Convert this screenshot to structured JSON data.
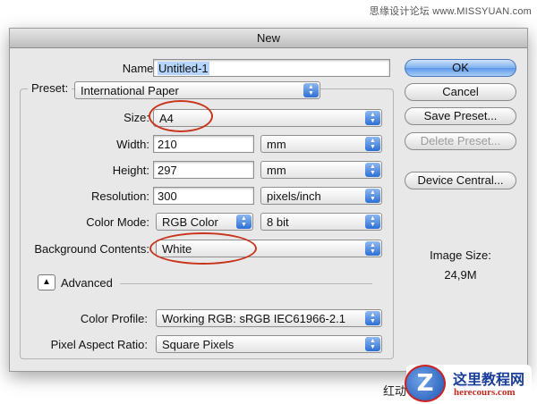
{
  "watermark_top": "思缘设计论坛 www.MISSYUAN.com",
  "dialog": {
    "title": "New",
    "name": {
      "label": "Name:",
      "value": "Untitled-1"
    },
    "preset": {
      "label": "Preset:",
      "value": "International Paper"
    },
    "size": {
      "label": "Size:",
      "value": "A4"
    },
    "width": {
      "label": "Width:",
      "value": "210",
      "unit": "mm"
    },
    "height": {
      "label": "Height:",
      "value": "297",
      "unit": "mm"
    },
    "resolution": {
      "label": "Resolution:",
      "value": "300",
      "unit": "pixels/inch"
    },
    "color_mode": {
      "label": "Color Mode:",
      "value": "RGB Color",
      "depth": "8 bit"
    },
    "background": {
      "label": "Background Contents:",
      "value": "White"
    },
    "advanced": {
      "label": "Advanced"
    },
    "color_profile": {
      "label": "Color Profile:",
      "value": "Working RGB:  sRGB IEC61966-2.1"
    },
    "pixel_aspect": {
      "label": "Pixel Aspect Ratio:",
      "value": "Square Pixels"
    },
    "buttons": {
      "ok": "OK",
      "cancel": "Cancel",
      "save_preset": "Save Preset...",
      "delete_preset": "Delete Preset...",
      "device_central": "Device Central..."
    },
    "image_size": {
      "label": "Image Size:",
      "value": "24,9M"
    }
  },
  "bottom_text": "红动",
  "logo": {
    "mark": "Z",
    "title": "这里教程网",
    "subtitle": "herecours.com"
  },
  "colors": {
    "highlight_ellipse": "#c8341c",
    "default_button": "#5a98e8"
  }
}
